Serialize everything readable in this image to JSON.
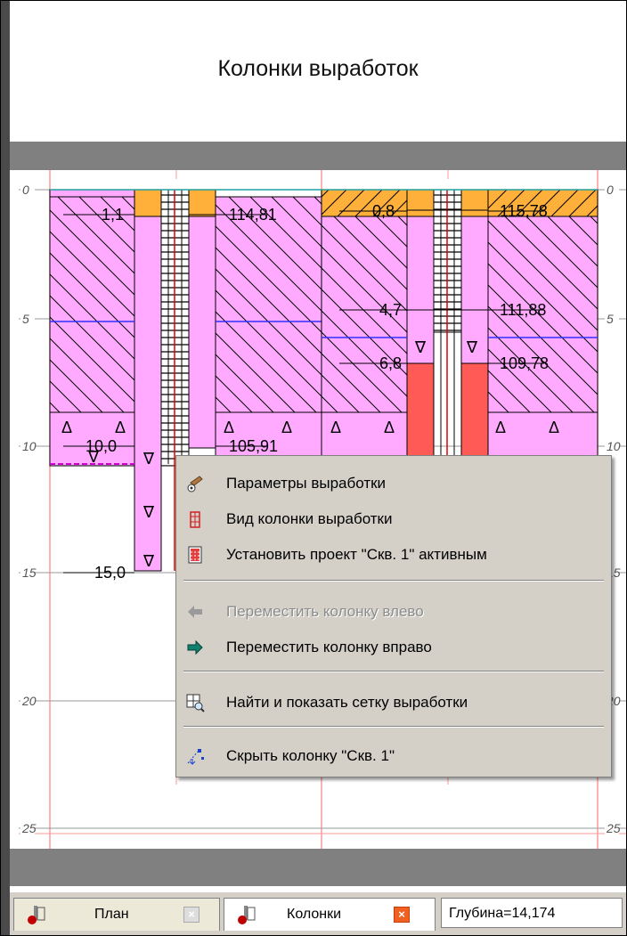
{
  "title": "Колонки выработок",
  "depth_scale": {
    "labels": [
      "0",
      "5",
      "10",
      "15",
      "20",
      "25"
    ]
  },
  "column1": {
    "labels_left": [
      "1,1",
      "10,0",
      "15,0"
    ],
    "labels_right": [
      "114,81",
      "105,91"
    ]
  },
  "column2": {
    "labels_left": [
      "0,8",
      "4,7",
      "6,8"
    ],
    "labels_right": [
      "115,78",
      "111,88",
      "109,78"
    ]
  },
  "context_menu": {
    "items": [
      {
        "label": "Параметры выработки",
        "icon": "parameters-icon",
        "enabled": true
      },
      {
        "label": "Вид колонки выработки",
        "icon": "column-view-icon",
        "enabled": true
      },
      {
        "label": "Установить проект \"Скв. 1\" активным",
        "icon": "project-icon",
        "enabled": true
      },
      {
        "label": "Переместить колонку влево",
        "icon": "arrow-left-icon",
        "enabled": false
      },
      {
        "label": "Переместить колонку вправо",
        "icon": "arrow-right-icon",
        "enabled": true
      },
      {
        "label": "Найти и показать сетку выработки",
        "icon": "find-grid-icon",
        "enabled": true
      },
      {
        "label": "Скрыть колонку \"Скв. 1\"",
        "icon": "hide-column-icon",
        "enabled": true
      }
    ]
  },
  "tabs": [
    {
      "label": "План",
      "active": false
    },
    {
      "label": "Колонки",
      "active": true
    }
  ],
  "status": {
    "depth": "Глубина=14,174"
  },
  "colors": {
    "fill_soil": "#ffaaff",
    "fill_top": "#ffb03b",
    "fill_red": "#ff5a55",
    "grid_red": "#ff9999",
    "water_line": "#3030ff"
  }
}
